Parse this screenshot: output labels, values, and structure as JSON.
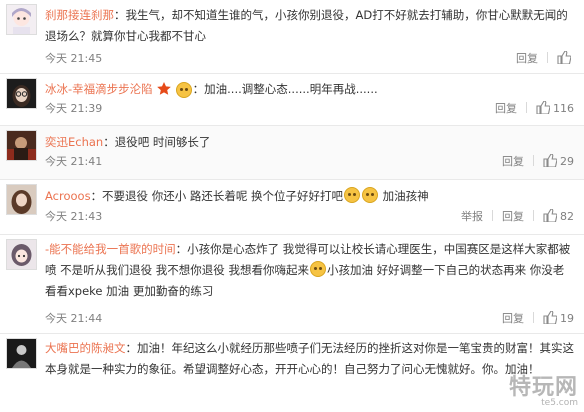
{
  "colors": {
    "username": "#eb7350",
    "meta": "#808080",
    "emoji": "#f6c343"
  },
  "reply_label": "回复",
  "report_label": "举报",
  "comments": [
    {
      "user": "刹那接连刹那",
      "text": "：我生气，却不知道生谁的气，小孩你别退役，AD打不好就去打辅助，你甘心默默无闻的退场么？就算你甘心我都不甘心",
      "time": "今天 21:45",
      "likes": "",
      "avatar_icon": "anime-avatar-icon"
    },
    {
      "user": "冰冰-幸福滴步步沦陷",
      "text": "：加油....调整心态......明年再战......",
      "time": "今天 21:39",
      "likes": "116",
      "avatar_icon": "glasses-avatar-icon"
    },
    {
      "user": "奕迅Echan",
      "text": "：退役吧 时间够长了",
      "time": "今天 21:41",
      "likes": "29",
      "avatar_icon": "dark-photo-avatar-icon"
    },
    {
      "user": "Acrooos",
      "text_before": "：不要退役 你还小 路还长着呢 换个位子好好打吧",
      "text_after": " 加油孩神",
      "time": "今天 21:43",
      "likes": "82",
      "avatar_icon": "girl-avatar-icon"
    },
    {
      "user": "-能不能给我一首歌的时间",
      "text_before": "：小孩你是心态炸了 我觉得可以让校长请心理医生，中国赛区是这样大家都被喷 不是听从我们退役 我不想你退役 我想看你嗨起来",
      "text_after": "小孩加油 好好调整一下自己的状态再来 你没老 看看xpeke 加油 更加勤奋的练习",
      "time": "今天 21:44",
      "likes": "19",
      "avatar_icon": "anime-girl-avatar-icon"
    },
    {
      "user": "大嘴巴的陈昶文",
      "text": "：加油！年纪这么小就经历那些喷子们无法经历的挫折这对你是一笔宝贵的财富！其实这本身就是一种实力的象征。希望调整好心态，开开心心的！自己努力了问心无愧就好。你。加油！",
      "time": "",
      "likes": "",
      "avatar_icon": "dark-avatar-icon"
    }
  ],
  "watermark": {
    "big": "特玩网",
    "small": "te5.com"
  }
}
